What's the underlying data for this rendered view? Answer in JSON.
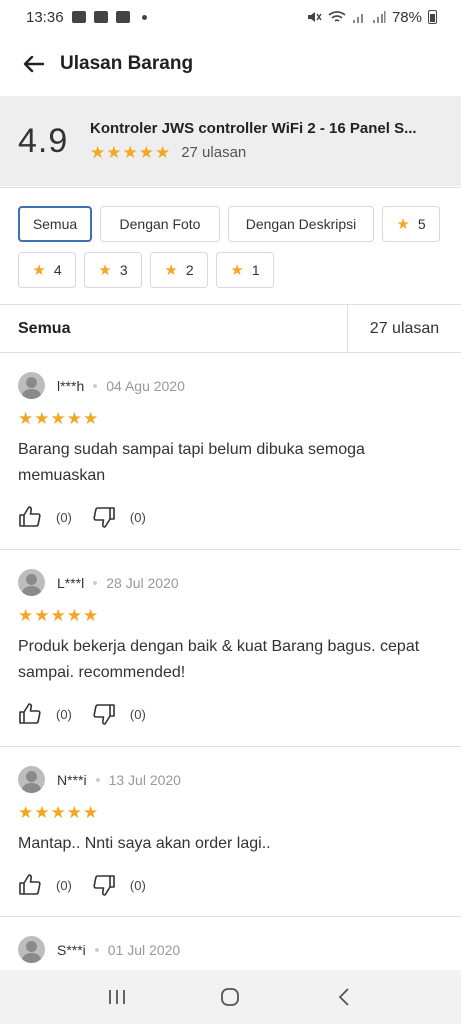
{
  "status_bar": {
    "time": "13:36",
    "battery": "78%"
  },
  "app_bar": {
    "title": "Ulasan Barang"
  },
  "product": {
    "rating": "4.9",
    "name": "Kontroler JWS controller WiFi  2 - 16 Panel S...",
    "stars": "★★★★★",
    "review_count": "27 ulasan"
  },
  "filters": {
    "all": "Semua",
    "with_photo": "Dengan Foto",
    "with_description": "Dengan Deskripsi",
    "star_5": "5",
    "star_4": "4",
    "star_3": "3",
    "star_2": "2",
    "star_1": "1"
  },
  "section": {
    "label": "Semua",
    "count": "27 ulasan"
  },
  "reviews": [
    {
      "name": "l***h",
      "date": "04 Agu 2020",
      "stars": "★★★★★",
      "text": "Barang sudah sampai tapi belum dibuka semoga memuaskan",
      "likes": "(0)",
      "dislikes": "(0)"
    },
    {
      "name": "L***l",
      "date": "28 Jul 2020",
      "stars": "★★★★★",
      "text": "Produk bekerja dengan baik & kuat Barang bagus. cepat sampai. recommended!",
      "likes": "(0)",
      "dislikes": "(0)"
    },
    {
      "name": "N***i",
      "date": "13 Jul 2020",
      "stars": "★★★★★",
      "text": "Mantap.. Nnti saya akan order lagi..",
      "likes": "(0)",
      "dislikes": "(0)"
    },
    {
      "name": "S***i",
      "date": "01 Jul 2020"
    }
  ],
  "colors": {
    "star": "#f5a623",
    "active_chip_border": "#3f6fb5",
    "header_bg": "#eeeeee"
  },
  "icons": {
    "back": "arrow-left-icon",
    "like": "thumbs-up-icon",
    "dislike": "thumbs-down-icon",
    "nav_recents": "recents-icon",
    "nav_home": "home-icon",
    "nav_back": "back-chevron-icon"
  }
}
